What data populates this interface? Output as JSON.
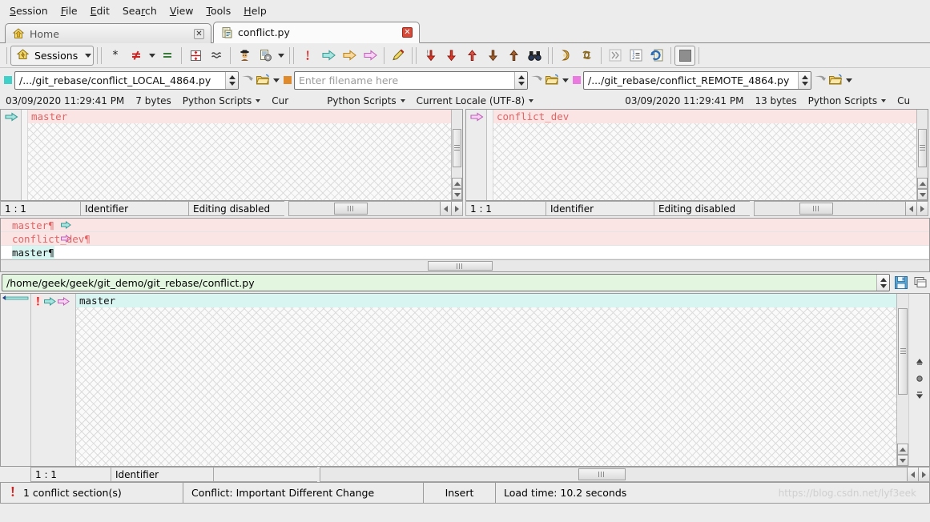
{
  "menu": {
    "items": [
      {
        "label": "Session",
        "accel": "S"
      },
      {
        "label": "File",
        "accel": "F"
      },
      {
        "label": "Edit",
        "accel": "E"
      },
      {
        "label": "Search",
        "accel": "r"
      },
      {
        "label": "View",
        "accel": "V"
      },
      {
        "label": "Tools",
        "accel": "T"
      },
      {
        "label": "Help",
        "accel": "H"
      }
    ]
  },
  "tabs": [
    {
      "label": "Home",
      "icon": "home-icon",
      "active": false,
      "closable": true
    },
    {
      "label": "conflict.py",
      "icon": "python-file-icon",
      "active": true,
      "closable": true
    }
  ],
  "toolbar": {
    "sessions_label": "Sessions",
    "buttons": [
      {
        "name": "session-home-icon",
        "glyph": "home"
      },
      {
        "name": "show-all-icon",
        "glyph": "asterisk"
      },
      {
        "name": "show-differences-icon",
        "glyph": "not-equal"
      },
      {
        "name": "show-same-icon",
        "glyph": "equal"
      },
      {
        "name": "align-lines-icon",
        "glyph": "align"
      },
      {
        "name": "minor-differences-icon",
        "glyph": "approx"
      },
      {
        "name": "ignore-unimportant-icon",
        "glyph": "detective"
      },
      {
        "name": "rules-icon",
        "glyph": "rules-gear"
      },
      {
        "name": "next-conflict-icon",
        "glyph": "exclamation"
      },
      {
        "name": "copy-to-right-icon",
        "glyph": "arrow-teal"
      },
      {
        "name": "copy-to-center-icon",
        "glyph": "arrow-orange"
      },
      {
        "name": "copy-to-left-icon",
        "glyph": "arrow-pink"
      },
      {
        "name": "edit-icon",
        "glyph": "pencil"
      },
      {
        "name": "next-conflict-down-icon",
        "glyph": "conflict-down"
      },
      {
        "name": "next-difference-down-icon",
        "glyph": "red-down"
      },
      {
        "name": "previous-difference-icon",
        "glyph": "red-up"
      },
      {
        "name": "next-section-down-icon",
        "glyph": "brown-down"
      },
      {
        "name": "previous-section-icon",
        "glyph": "brown-up"
      },
      {
        "name": "find-icon",
        "glyph": "binoculars"
      },
      {
        "name": "swap-sides-icon",
        "glyph": "swap"
      },
      {
        "name": "refresh-icon",
        "glyph": "refresh"
      },
      {
        "name": "more-icon",
        "glyph": "chevrons"
      },
      {
        "name": "line-numbers-icon",
        "glyph": "numbered-list"
      },
      {
        "name": "reload-icon",
        "glyph": "reload-page"
      },
      {
        "name": "stop-icon",
        "glyph": "stop-square"
      }
    ]
  },
  "paths": {
    "left": {
      "value": "/.../git_rebase/conflict_LOCAL_4864.py",
      "placeholder": "Enter filename here",
      "swatch": "#3fd0c9"
    },
    "center": {
      "value": "",
      "placeholder": "Enter filename here",
      "swatch": "#e08a2e"
    },
    "right": {
      "value": "/.../git_rebase/conflict_REMOTE_4864.py",
      "placeholder": "Enter filename here",
      "swatch": "#ea7ae0"
    }
  },
  "fileinfo": {
    "left": {
      "timestamp": "03/09/2020 11:29:41 PM",
      "size": "7 bytes",
      "format": "Python Scripts",
      "encoding": "Cur"
    },
    "center": {
      "format": "Python Scripts",
      "encoding": "Current Locale (UTF-8)"
    },
    "right": {
      "timestamp": "03/09/2020 11:29:41 PM",
      "size": "13 bytes",
      "format": "Python Scripts",
      "encoding": "Cu"
    }
  },
  "diff_panes": {
    "left": {
      "line": "master",
      "line_color": "#e06666",
      "line_bg": "#fbe4e4",
      "arrow_color": "#3fd0c9",
      "status": {
        "position": "1 : 1",
        "syntax": "Identifier",
        "state": "Editing disabled"
      }
    },
    "right": {
      "line": "conflict_dev",
      "line_color": "#e06666",
      "line_bg": "#fbe4e4",
      "arrow_color": "#ea7ae0",
      "status": {
        "position": "1 : 1",
        "syntax": "Identifier",
        "state": "Editing disabled"
      }
    }
  },
  "merge_preview": {
    "lines": [
      {
        "text": "master¶",
        "color": "#e06666",
        "bg": "#fbe4e4",
        "mark": "arrow-teal",
        "indent": 0
      },
      {
        "text": "conflict_dev¶",
        "color": "#e06666",
        "bg": "#fbe4e4",
        "mark": "arrow-pink",
        "indent": 0
      },
      {
        "text": "master¶",
        "color": "#111111",
        "bg": "#d9f5f2",
        "mark": "none",
        "indent": 1
      }
    ]
  },
  "output": {
    "path": "/home/geek/geek/git_demo/git_rebase/conflict.py",
    "save_icon": "save-icon",
    "layout_icon": "layout-icon",
    "bg": "#e3f7e0"
  },
  "editor": {
    "line": "master",
    "line_bg": "#d9f5f2",
    "markers": [
      "conflict-exclamation",
      "arrow-teal",
      "arrow-pink"
    ],
    "status": {
      "position": "1 : 1",
      "syntax": "Identifier",
      "state": "",
      "extra": ""
    },
    "vtools": [
      {
        "name": "editor-layout-icon",
        "glyph": "panes"
      },
      {
        "name": "scroll-top-icon",
        "glyph": "top"
      },
      {
        "name": "scroll-center-icon",
        "glyph": "center"
      },
      {
        "name": "scroll-bottom-icon",
        "glyph": "bottom"
      }
    ]
  },
  "statusbar": {
    "conflicts": "1 conflict section(s)",
    "conflict_icon": "exclamation-icon",
    "conflict_type": "Conflict: Important Different Change",
    "insert_mode": "Insert",
    "load_time": "Load time: 10.2 seconds",
    "watermark": "https://blog.csdn.net/lyf3eek"
  }
}
